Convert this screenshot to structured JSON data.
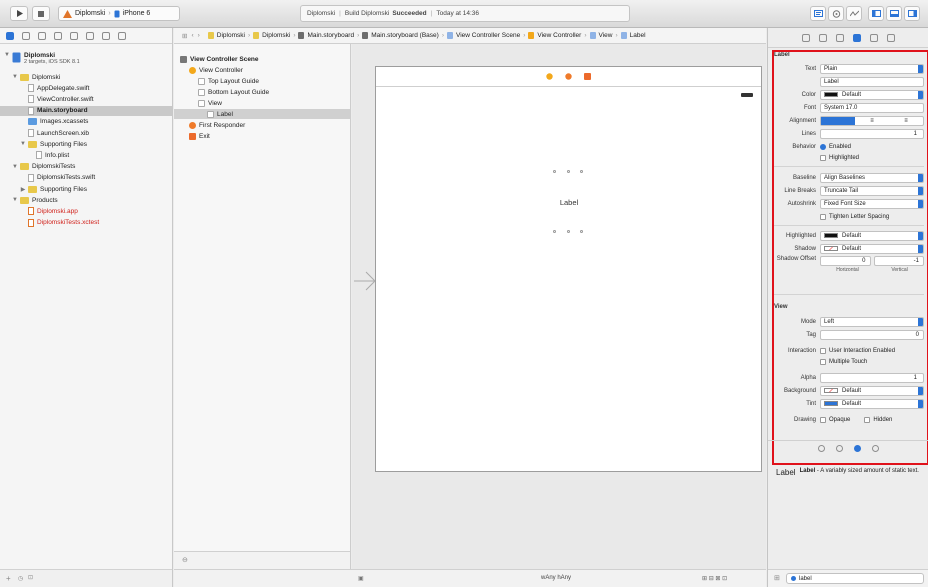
{
  "toolbar": {
    "scheme": "Diplomski",
    "device": "iPhone 6",
    "activity": {
      "project": "Diplomski",
      "status_prefix": "Build Diplomski",
      "status_bold": "Succeeded",
      "time": "Today at 14:36"
    }
  },
  "navigator": {
    "project_name": "Diplomski",
    "project_sub": "2 targets, iOS SDK 8.1",
    "items": [
      {
        "label": "Diplomski",
        "kind": "folder",
        "indent": 1,
        "disclosure": "open"
      },
      {
        "label": "AppDelegate.swift",
        "kind": "file",
        "indent": 2
      },
      {
        "label": "ViewController.swift",
        "kind": "file",
        "indent": 2
      },
      {
        "label": "Main.storyboard",
        "kind": "file",
        "indent": 2,
        "selected": true
      },
      {
        "label": "Images.xcassets",
        "kind": "folder-blue",
        "indent": 2
      },
      {
        "label": "LaunchScreen.xib",
        "kind": "file",
        "indent": 2
      },
      {
        "label": "Supporting Files",
        "kind": "folder",
        "indent": 2,
        "disclosure": "open"
      },
      {
        "label": "Info.plist",
        "kind": "file",
        "indent": 3
      },
      {
        "label": "DiplomskiTests",
        "kind": "folder",
        "indent": 1,
        "disclosure": "open"
      },
      {
        "label": "DiplomskiTests.swift",
        "kind": "file",
        "indent": 2
      },
      {
        "label": "Supporting Files",
        "kind": "folder",
        "indent": 2,
        "disclosure": "closed"
      },
      {
        "label": "Products",
        "kind": "folder",
        "indent": 1,
        "disclosure": "open"
      },
      {
        "label": "Diplomski.app",
        "kind": "product",
        "indent": 2,
        "red": true
      },
      {
        "label": "DiplomskiTests.xctest",
        "kind": "product",
        "indent": 2,
        "red": true
      }
    ]
  },
  "jumpbar": {
    "crumbs": [
      "Diplomski",
      "Diplomski",
      "Main.storyboard",
      "Main.storyboard (Base)",
      "View Controller Scene",
      "View Controller",
      "View",
      "Label"
    ]
  },
  "outline": {
    "items": [
      {
        "label": "View Controller Scene",
        "indent": 0,
        "bold": true
      },
      {
        "label": "View Controller",
        "indent": 1
      },
      {
        "label": "Top Layout Guide",
        "indent": 2
      },
      {
        "label": "Bottom Layout Guide",
        "indent": 2
      },
      {
        "label": "View",
        "indent": 2
      },
      {
        "label": "Label",
        "indent": 3,
        "selected": true
      },
      {
        "label": "First Responder",
        "indent": 1
      },
      {
        "label": "Exit",
        "indent": 1
      }
    ]
  },
  "canvas": {
    "label_text": "Label",
    "size_class": "wAny hAny"
  },
  "inspector": {
    "label_section": "Label",
    "text_type": "Plain",
    "text_value": "Label",
    "color": "Default",
    "font": "System 17.0",
    "lines": "1",
    "behavior_enabled": "Enabled",
    "behavior_highlighted": "Highlighted",
    "baseline": "Align Baselines",
    "line_breaks": "Truncate Tail",
    "autoshrink": "Fixed Font Size",
    "tighten": "Tighten Letter Spacing",
    "highlighted": "Default",
    "shadow": "Default",
    "shadow_offset_h": "0",
    "shadow_offset_v": "-1",
    "horizontal": "Horizontal",
    "vertical": "Vertical",
    "view_section": "View",
    "mode": "Left",
    "tag": "0",
    "interaction_user": "User Interaction Enabled",
    "interaction_multi": "Multiple Touch",
    "alpha": "1",
    "background": "Default",
    "tint": "Default",
    "drawing_opaque": "Opaque",
    "drawing_hidden": "Hidden",
    "labels": {
      "text": "Text",
      "color": "Color",
      "font": "Font",
      "alignment": "Alignment",
      "lines": "Lines",
      "behavior": "Behavior",
      "baseline": "Baseline",
      "line_breaks": "Line Breaks",
      "autoshrink": "Autoshrink",
      "highlighted": "Highlighted",
      "shadow": "Shadow",
      "shadow_offset": "Shadow Offset",
      "mode": "Mode",
      "tag": "Tag",
      "interaction": "Interaction",
      "alpha": "Alpha",
      "background": "Background",
      "tint": "Tint",
      "drawing": "Drawing"
    },
    "library": {
      "icon_text": "Label",
      "title": "Label",
      "desc": "- A variably sized amount of static text."
    },
    "filter": "label"
  }
}
